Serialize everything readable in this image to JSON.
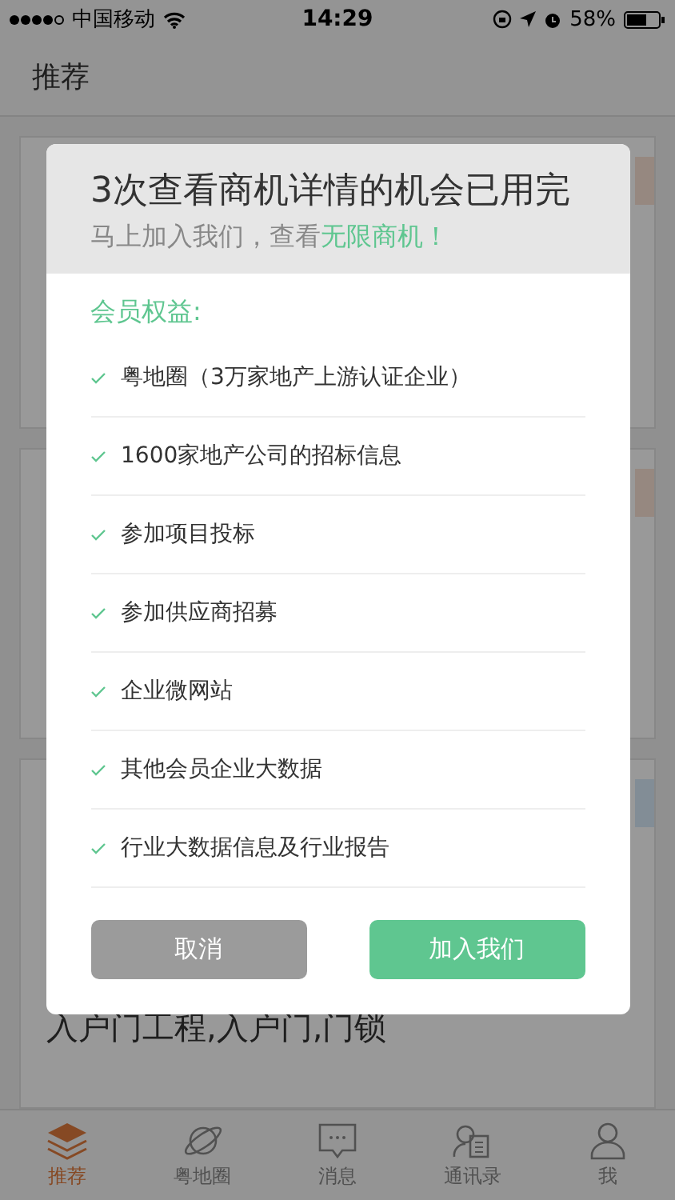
{
  "status_bar": {
    "carrier": "中国移动",
    "time": "14:29",
    "battery": "58%"
  },
  "header": {
    "title": "推荐"
  },
  "feed": {
    "visible_text": "入户门工程,入户门,门锁"
  },
  "dialog": {
    "title": "3次查看商机详情的机会已用完",
    "subtitle": "马上加入我们，查看**无限商机！**",
    "benefits_title": "会员权益:",
    "benefits": [
      "粤地圈（3万家地产上游认证企业）",
      "1600家地产公司的招标信息",
      "参加项目投标",
      "参加供应商招募",
      "企业微网站",
      "其他会员企业大数据",
      "行业大数据信息及行业报告"
    ],
    "buttons": [
      {
        "label": "取消",
        "kind": "cancel"
      },
      {
        "label": "加入我们",
        "kind": "primary"
      }
    ]
  },
  "tab_bar": [
    {
      "label": "推荐",
      "selected": true
    },
    {
      "label": "粤地圈",
      "selected": false
    },
    {
      "label": "消息",
      "selected": false
    },
    {
      "label": "通讯录",
      "selected": false
    },
    {
      "label": "我",
      "selected": false
    }
  ]
}
